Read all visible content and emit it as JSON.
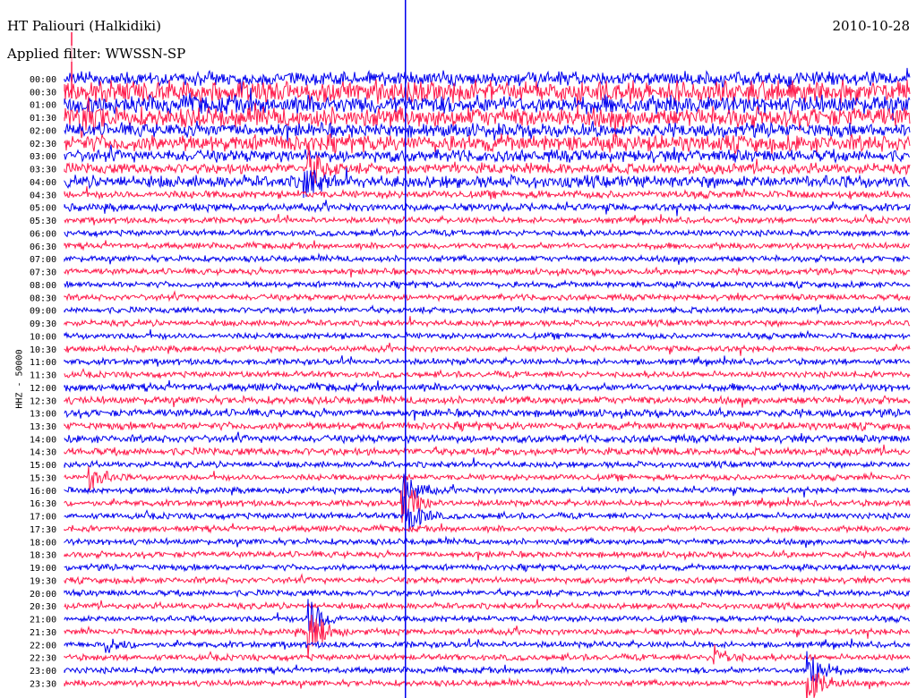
{
  "header": {
    "station": "HT Paliouri (Halkidiki)",
    "date": "2010-10-28",
    "filter": "Applied filter: WWSSN-SP"
  },
  "channel_label": "HHZ - 50000",
  "colors": {
    "trace_a": "#0000ee",
    "trace_b": "#ff1a4b",
    "marker": "#0000ee"
  },
  "chart_data": {
    "type": "line",
    "title": "HT Paliouri (Halkidiki)",
    "ylabel": "HHZ - 50000",
    "xlabel": "",
    "row_labels": [
      "00:00",
      "00:30",
      "01:00",
      "01:30",
      "02:00",
      "02:30",
      "03:00",
      "03:30",
      "04:00",
      "04:30",
      "05:00",
      "05:30",
      "06:00",
      "06:30",
      "07:00",
      "07:30",
      "08:00",
      "08:30",
      "09:00",
      "09:30",
      "10:00",
      "10:30",
      "11:00",
      "11:30",
      "12:00",
      "12:30",
      "13:00",
      "13:30",
      "14:00",
      "14:30",
      "15:00",
      "15:30",
      "16:00",
      "16:30",
      "17:00",
      "17:30",
      "18:00",
      "18:30",
      "19:00",
      "19:30",
      "20:00",
      "20:30",
      "21:00",
      "21:30",
      "22:00",
      "22:30",
      "23:00",
      "23:30"
    ],
    "row_noise_level": [
      9,
      14,
      12,
      13,
      9,
      11,
      8,
      7,
      8,
      5,
      5,
      4,
      4,
      4,
      4,
      4,
      4,
      4,
      4,
      4,
      4,
      4,
      4,
      4,
      5,
      5,
      5,
      5,
      5,
      5,
      4,
      4,
      4,
      4,
      4,
      4,
      4,
      4,
      4,
      4,
      4,
      4,
      4,
      4,
      4,
      4,
      4,
      4
    ],
    "events": [
      {
        "row": 3,
        "minute": 0.5,
        "amplitude": 25
      },
      {
        "row": 7,
        "minute": 8.7,
        "amplitude": 22
      },
      {
        "row": 8,
        "minute": 8.5,
        "amplitude": 18
      },
      {
        "row": 31,
        "minute": 0.9,
        "amplitude": 14
      },
      {
        "row": 32,
        "minute": 12.0,
        "amplitude": 22
      },
      {
        "row": 33,
        "minute": 12.0,
        "amplitude": 30
      },
      {
        "row": 34,
        "minute": 12.1,
        "amplitude": 24
      },
      {
        "row": 42,
        "minute": 8.7,
        "amplitude": 22
      },
      {
        "row": 43,
        "minute": 8.7,
        "amplitude": 30
      },
      {
        "row": 44,
        "minute": 1.5,
        "amplitude": 8
      },
      {
        "row": 45,
        "minute": 23.1,
        "amplitude": 12
      },
      {
        "row": 46,
        "minute": 26.4,
        "amplitude": 26
      },
      {
        "row": 47,
        "minute": 26.4,
        "amplitude": 24
      }
    ],
    "marker_minute": 12.1,
    "minutes_per_row": 30,
    "grid": false
  }
}
